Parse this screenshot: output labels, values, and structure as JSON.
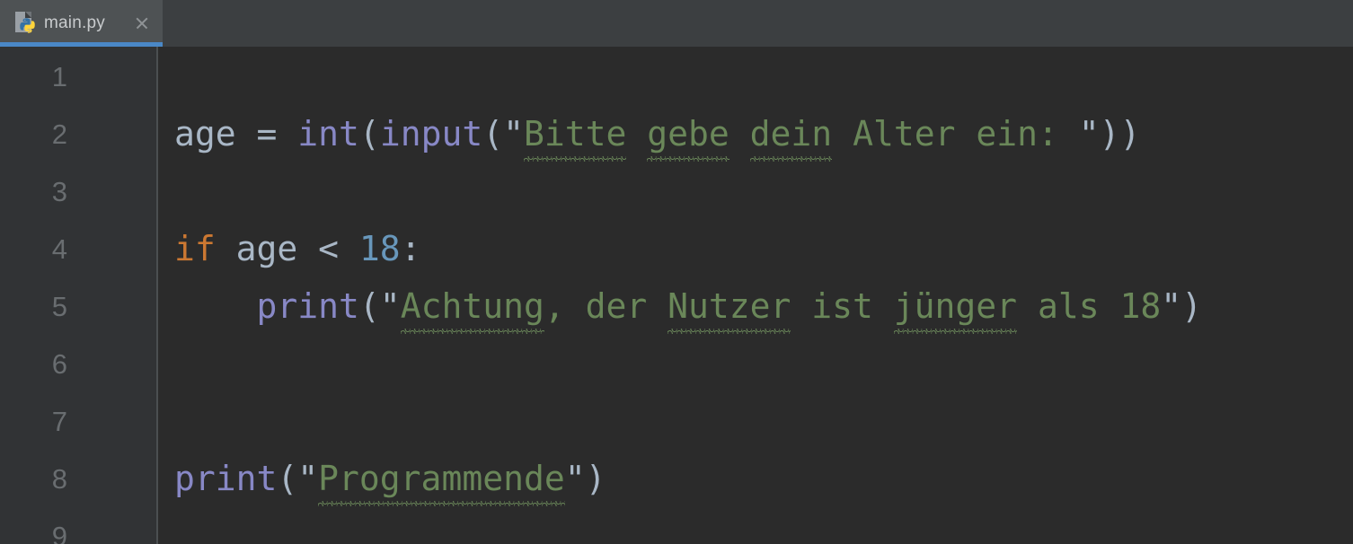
{
  "window": {
    "background_color": "#2b2b2b",
    "tabbar_color": "#3c3f41",
    "active_tab_color": "#4e5254",
    "accent_color": "#4a88c7",
    "gutter_color": "#313335"
  },
  "tabbar": {
    "tabs": [
      {
        "label": "main.py",
        "icon": "python-file-icon",
        "active": true,
        "close_icon": "close-icon"
      }
    ]
  },
  "editor": {
    "language": "Python",
    "gutter": {
      "line_numbers": [
        "1",
        "2",
        "3",
        "4",
        "5",
        "6",
        "7",
        "8",
        "9"
      ]
    },
    "syntax_colors": {
      "default": "#a9b7c6",
      "keyword": "#cc7832",
      "function": "#8888c6",
      "string": "#6a8759",
      "number": "#6897bb",
      "typo_underline": "#6a8759"
    },
    "lines": [
      {
        "number": "1",
        "text": ""
      },
      {
        "number": "2",
        "text": "age = int(input(\"Bitte gebe dein Alter ein: \"))"
      },
      {
        "number": "3",
        "text": ""
      },
      {
        "number": "4",
        "text": "if age < 18:"
      },
      {
        "number": "5",
        "text": "    print(\"Achtung, der Nutzer ist jünger als 18\")"
      },
      {
        "number": "6",
        "text": ""
      },
      {
        "number": "7",
        "text": ""
      },
      {
        "number": "8",
        "text": "print(\"Programmende\")"
      },
      {
        "number": "9",
        "text": ""
      }
    ],
    "tokens": {
      "l2_name": "age",
      "l2_eq": " = ",
      "l2_int": "int",
      "l2_paren1": "(",
      "l2_input": "input",
      "l2_paren2": "(",
      "l2_quote_open": "\"",
      "l2_word1": "Bitte",
      "l2_sp1": " ",
      "l2_word2": "gebe",
      "l2_sp2": " ",
      "l2_word3": "dein",
      "l2_rest": " Alter ein: ",
      "l2_quote_close": "\"",
      "l2_close": "))",
      "l4_if": "if",
      "l4_name": " age ",
      "l4_op": "< ",
      "l4_num": "18",
      "l4_colon": ":",
      "l5_indent": "    ",
      "l5_print": "print",
      "l5_paren": "(",
      "l5_quote_open": "\"",
      "l5_word1": "Achtung",
      "l5_mid1": ", der ",
      "l5_word2": "Nutzer",
      "l5_mid2": " ist ",
      "l5_word3": "jünger",
      "l5_rest": " als 18",
      "l5_quote_close": "\"",
      "l5_close": ")",
      "l8_print": "print",
      "l8_paren": "(",
      "l8_quote_open": "\"",
      "l8_word1": "Programmende",
      "l8_quote_close": "\"",
      "l8_close": ")"
    },
    "spellcheck_words": [
      "Bitte",
      "gebe",
      "dein",
      "Achtung",
      "Nutzer",
      "jünger",
      "Programmende"
    ]
  }
}
